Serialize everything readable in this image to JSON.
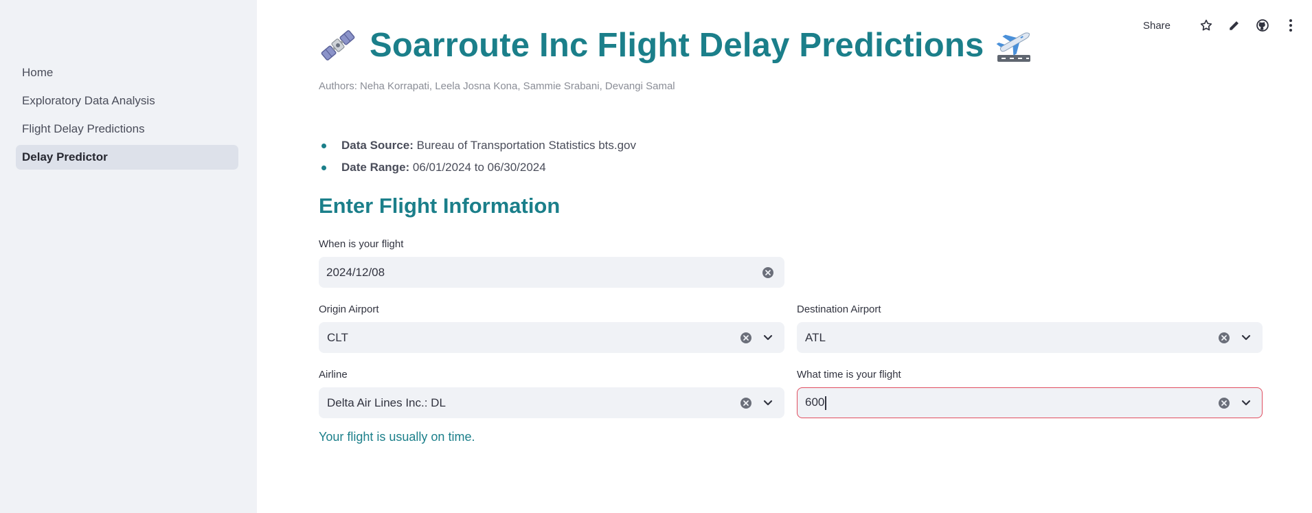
{
  "sidebar": {
    "items": [
      {
        "label": "Home"
      },
      {
        "label": "Exploratory Data Analysis"
      },
      {
        "label": "Flight Delay Predictions"
      },
      {
        "label": "Delay Predictor",
        "active": true
      }
    ]
  },
  "toolbar": {
    "share_label": "Share",
    "icons": [
      "star-icon",
      "pencil-icon",
      "github-icon",
      "more-vertical-icon"
    ]
  },
  "header": {
    "title_part1": "Soarroute Inc",
    "title_part2": "Flight Delay Predictions",
    "emoji_left": "satellite-emoji",
    "emoji_right": "airplane-departure-emoji",
    "authors": "Authors: Neha Korrapati, Leela Josna Kona, Sammie Srabani, Devangi Samal"
  },
  "info": {
    "data_source_label": "Data Source:",
    "data_source_value": "Bureau of Transportation Statistics bts.gov",
    "date_range_label": "Date Range:",
    "date_range_value": "06/01/2024 to 06/30/2024"
  },
  "form": {
    "section_title": "Enter Flight Information",
    "date": {
      "label": "When is your flight",
      "value": "2024/12/08"
    },
    "origin": {
      "label": "Origin Airport",
      "value": "CLT"
    },
    "destination": {
      "label": "Destination Airport",
      "value": "ATL"
    },
    "airline": {
      "label": "Airline",
      "value": "Delta Air Lines Inc.: DL"
    },
    "time": {
      "label": "What time is your flight",
      "value": "600"
    }
  },
  "result": {
    "message": "Your flight is usually on time."
  },
  "colors": {
    "teal": "#1b7f8a",
    "green": "#2e8a3e",
    "sidebar_bg": "#f0f2f6",
    "focus_border": "#e04d5f"
  }
}
